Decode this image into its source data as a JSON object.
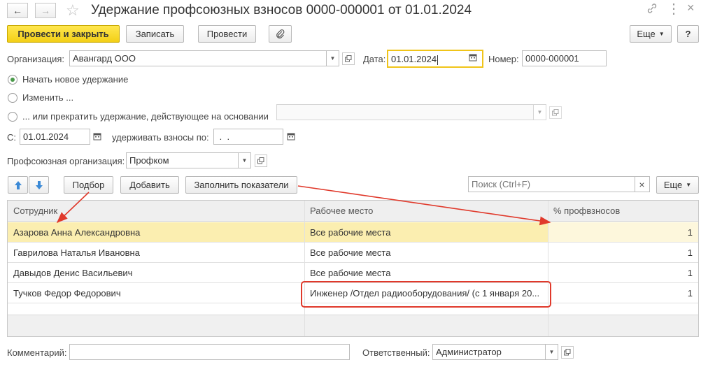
{
  "window": {
    "title": "Удержание профсоюзных взносов 0000-000001 от 01.01.2024"
  },
  "toolbar": {
    "post_close": "Провести и закрыть",
    "save": "Записать",
    "post": "Провести",
    "more": "Еще",
    "help": "?"
  },
  "header": {
    "org_label": "Организация:",
    "org_value": "Авангард ООО",
    "date_label": "Дата:",
    "date_value": "01.01.2024",
    "number_label": "Номер:",
    "number_value": "0000-000001"
  },
  "options": {
    "new": "Начать новое удержание",
    "change": "Изменить ...",
    "stop": "... или прекратить удержание, действующее на основании",
    "basis_value": ""
  },
  "period": {
    "from_label": "С:",
    "from_value": "01.01.2024",
    "until_label": "удерживать взносы по:",
    "until_value": " .  ."
  },
  "union": {
    "label": "Профсоюзная организация:",
    "value": "Профком"
  },
  "table_toolbar": {
    "pick": "Подбор",
    "add": "Добавить",
    "fill": "Заполнить показатели",
    "search_placeholder": "Поиск (Ctrl+F)",
    "more": "Еще"
  },
  "table": {
    "columns": [
      "Сотрудник",
      "Рабочее место",
      "% профвзносов"
    ],
    "rows": [
      {
        "employee": "Азарова Анна Александровна",
        "workplace": "Все рабочие места",
        "percent": "1"
      },
      {
        "employee": "Гаврилова Наталья Ивановна",
        "workplace": "Все рабочие места",
        "percent": "1"
      },
      {
        "employee": "Давыдов Денис Васильевич",
        "workplace": "Все рабочие места",
        "percent": "1"
      },
      {
        "employee": "Тучков Федор Федорович",
        "workplace": "Инженер /Отдел радиооборудования/ (с 1 января 20...",
        "percent": "1"
      }
    ]
  },
  "footer": {
    "comment_label": "Комментарий:",
    "comment_value": "",
    "responsible_label": "Ответственный:",
    "responsible_value": "Администратор"
  },
  "colors": {
    "primary_button": "#f3cf16",
    "selected_row": "#fbeeb0",
    "annotation": "#e0392b"
  }
}
